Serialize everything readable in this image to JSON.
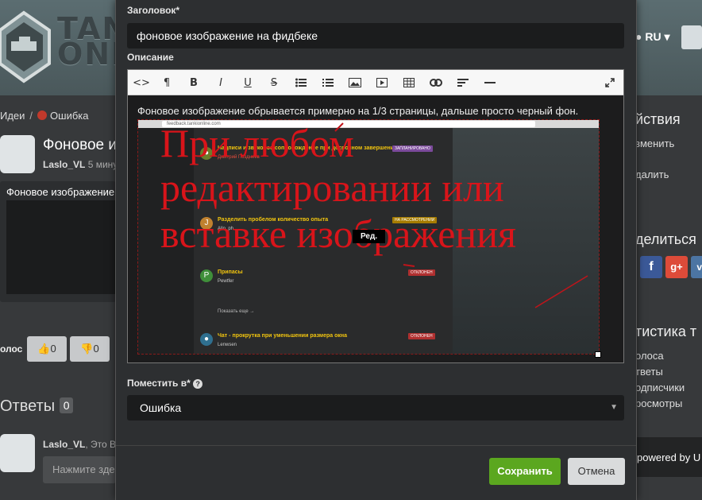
{
  "background": {
    "logo_text_1": "TAN",
    "logo_text_2": "ONL",
    "language": "RU",
    "breadcrumb": [
      "Идеи",
      "Ошибка"
    ],
    "idea_title": "Фоновое и",
    "idea_author": "Laslo_VL",
    "idea_time": "5 минут",
    "card_title": "Фоновое изображение",
    "vote_label": "олос",
    "vote_up_count": "0",
    "vote_down_count": "0",
    "answers_label": "Ответы",
    "answers_count": "0",
    "reply_author": "Laslo_VL",
    "reply_meta": ", Это Вы",
    "reply_placeholder": "Нажмите зде",
    "right": {
      "actions_heading": "йствия",
      "edit": "зменить",
      "delete": "далить",
      "share_heading": "делиться",
      "stats_heading": "тистика т",
      "stats_items": [
        "олоса",
        "тветы",
        "одписчики",
        "росмотры"
      ],
      "powered": "powered by U"
    },
    "colors": {
      "facebook": "#3b5998",
      "google": "#dd4b39",
      "vk": "#4c75a3"
    }
  },
  "modal": {
    "title_label": "Заголовок",
    "title_value": "фоновое изображение на фидбеке",
    "description_label": "Описание",
    "toolbar": [
      "code-icon",
      "paragraph-icon",
      "bold-icon",
      "italic-icon",
      "underline-icon",
      "strikethrough-icon",
      "bulleted-list-icon",
      "numbered-list-icon",
      "image-icon",
      "video-icon",
      "table-icon",
      "link-icon",
      "align-icon",
      "horizontal-rule-icon",
      "fullscreen-icon"
    ],
    "body_text": "Фоновое изображение обрывается примерно на 1/3 страницы, дальше просто черный фон.",
    "embedded_screenshot": {
      "url": "feedback.tankionline.com",
      "overlay_line_1": "При любом",
      "overlay_line_2": "редактировании или",
      "overlay_line_3": "вставке изображения",
      "edit_label": "Ред.",
      "posts": [
        {
          "title": "Надписи и звуковое сопровождение при досрочном завершении би...",
          "badge": "ЗАПЛАНИРОВАНО",
          "author": "Дмитрий Позднеев"
        },
        {
          "title": "Разделить пробелом количество опыта",
          "badge": "НА РАССМОТРЕНИИ",
          "author": "Allo_ph"
        },
        {
          "title": "Припасы",
          "badge": "ОТКЛОНЕН",
          "author": "Pewtfer"
        },
        {
          "title": "Чат - прокрутка при уменьшении размера окна",
          "badge": "ОТКЛОНЕН",
          "author": "Lenwsen"
        }
      ],
      "show_more": "Показать еще →"
    },
    "place_label": "Поместить в",
    "place_value": "Ошибка",
    "save_label": "Сохранить",
    "cancel_label": "Отмена"
  }
}
